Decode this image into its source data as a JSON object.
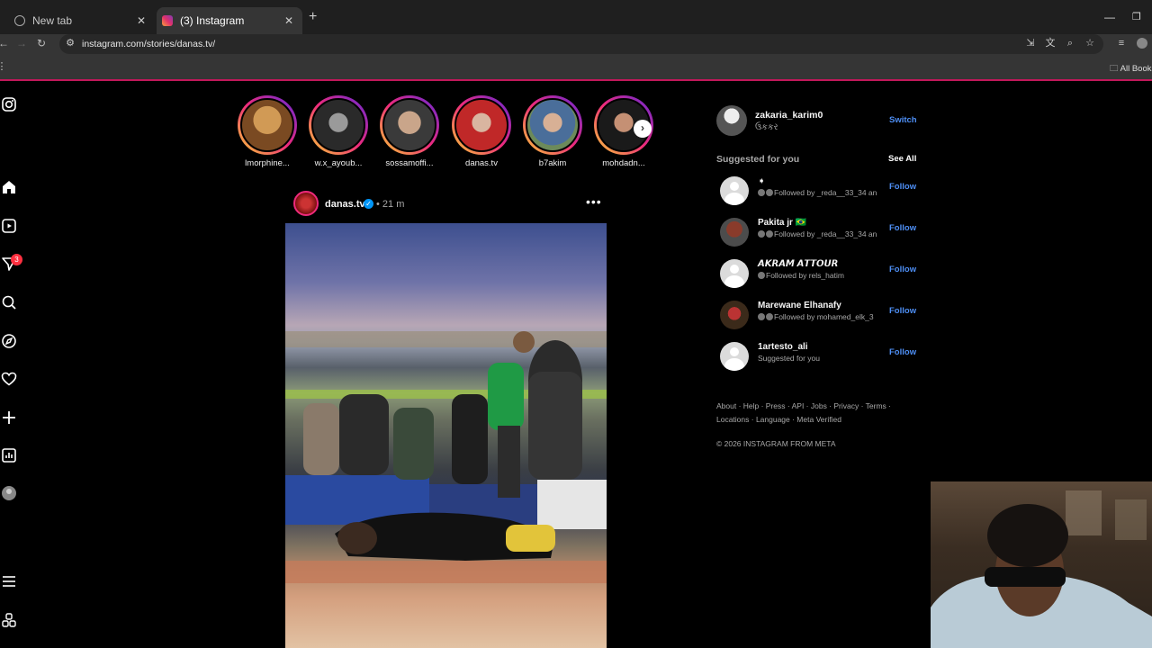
{
  "browser": {
    "tabs": [
      {
        "label": "New tab",
        "active": false
      },
      {
        "label": "(3) Instagram",
        "active": true
      }
    ],
    "url": "instagram.com/stories/danas.tv/",
    "bookmarks_label": "All Book"
  },
  "sidebar": {
    "items": [
      "instagram-logo",
      "home",
      "reels",
      "messages",
      "search",
      "explore",
      "notifications",
      "create",
      "dashboard",
      "profile",
      "more",
      "also-from-meta"
    ],
    "messages_badge": "3"
  },
  "stories": [
    {
      "name": "lmorphine...",
      "color": "#8a5a2a"
    },
    {
      "name": "w.x_ayoub...",
      "color": "#5a5a5a"
    },
    {
      "name": "sossamoffi...",
      "color": "#6a6560"
    },
    {
      "name": "danas.tv",
      "color": "#b53030"
    },
    {
      "name": "b7akim",
      "color": "#5a7a5a"
    },
    {
      "name": "mohdadn...",
      "color": "#3a2a2a"
    }
  ],
  "post": {
    "username": "danas.tv",
    "time": "21 m",
    "separator": "•"
  },
  "account": {
    "username": "zakaria_karim0",
    "subtitle": "ઉકકર",
    "switch_label": "Switch"
  },
  "suggestions": {
    "title": "Suggested for you",
    "see_all": "See All",
    "follow_label": "Follow",
    "items": [
      {
        "name": "➧",
        "meta": "Followed by _reda__33_34 an"
      },
      {
        "name": "Pakita jr 🇧🇷",
        "meta": "Followed by _reda__33_34 an"
      },
      {
        "name": "𝘼𝙆𝙍𝘼𝙈 𝘼𝙏𝙏𝙊𝙐𝙍",
        "meta": "Followed by rels_hatim"
      },
      {
        "name": "Marewane Elhanafy",
        "meta": "Followed by mohamed_elk_3"
      },
      {
        "name": "1artesto_ali",
        "meta": "Suggested for you"
      }
    ]
  },
  "footer": {
    "links_line1": "About · Help · Press · API · Jobs · Privacy · Terms ·",
    "links_line2": "Locations · Language · Meta Verified",
    "copyright": "© 2026 INSTAGRAM FROM META"
  },
  "colors": {
    "link_blue": "#4e8ff5",
    "notif_red": "#ff3040",
    "verified": "#0095f6"
  }
}
